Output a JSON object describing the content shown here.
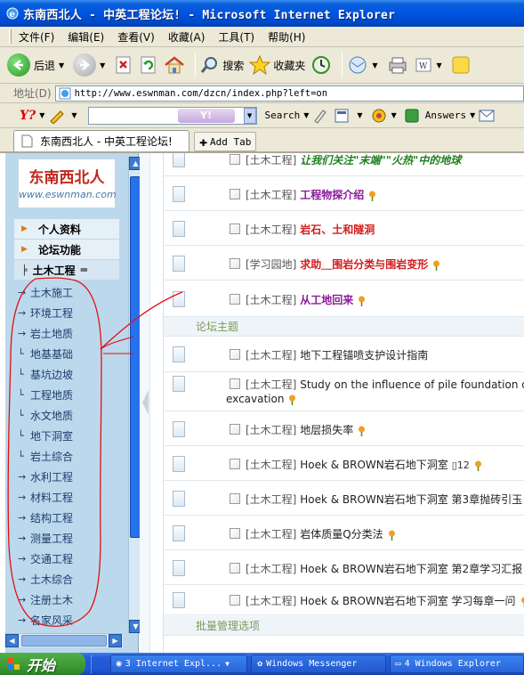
{
  "window": {
    "title": "东南西北人 - 中英工程论坛! - Microsoft Internet Explorer"
  },
  "menubar": {
    "items": [
      "文件(F)",
      "编辑(E)",
      "查看(V)",
      "收藏(A)",
      "工具(T)",
      "帮助(H)"
    ]
  },
  "toolbar": {
    "back_label": "后退",
    "search_label": "搜索",
    "favorites_label": "收藏夹"
  },
  "address": {
    "label": "地址(D)",
    "url": "http://www.eswnman.com/dzcn/index.php?left=on"
  },
  "yahoo_toolbar": {
    "logo": "Y?",
    "watermark": "Y!",
    "search_label": "Search",
    "answers_label": "Answers"
  },
  "tabs": {
    "active_tab": "东南西北人 - 中英工程论坛!",
    "add_tab_label": "Add Tab"
  },
  "left_frame": {
    "logo_cn": "东南西北人",
    "logo_en": "www.eswnman.com",
    "menu": [
      "个人资料",
      "论坛功能"
    ],
    "current_section": "土木工程",
    "categories": [
      {
        "prefix": "→",
        "label": "土木施工"
      },
      {
        "prefix": "→",
        "label": "环境工程"
      },
      {
        "prefix": "→",
        "label": "岩土地质"
      },
      {
        "prefix": "└",
        "label": "地基基础"
      },
      {
        "prefix": "└",
        "label": "基坑边坡"
      },
      {
        "prefix": "└",
        "label": "工程地质"
      },
      {
        "prefix": "└",
        "label": "水文地质"
      },
      {
        "prefix": "└",
        "label": "地下洞室"
      },
      {
        "prefix": "└",
        "label": "岩土综合"
      },
      {
        "prefix": "→",
        "label": "水利工程"
      },
      {
        "prefix": "→",
        "label": "材料工程"
      },
      {
        "prefix": "→",
        "label": "结构工程"
      },
      {
        "prefix": "→",
        "label": "测量工程"
      },
      {
        "prefix": "→",
        "label": "交通工程"
      },
      {
        "prefix": "→",
        "label": "土木综合"
      },
      {
        "prefix": "→",
        "label": "注册土木"
      },
      {
        "prefix": "→",
        "label": "名家风采"
      }
    ]
  },
  "threads_top": [
    {
      "tag": "[土木工程]",
      "title": "让我们关注\"末端\"\"火热\"中的地球",
      "style": "green",
      "pin": false
    },
    {
      "tag": "[土木工程]",
      "title": "工程物探介绍",
      "style": "purple",
      "pin": true
    },
    {
      "tag": "[土木工程]",
      "title": "岩石、土和隧洞",
      "style": "red",
      "pin": false
    },
    {
      "tag": "[学习园地]",
      "title": "求助＿围岩分类与围岩变形",
      "style": "red",
      "pin": true
    },
    {
      "tag": "[土木工程]",
      "title": "从工地回来",
      "style": "purple",
      "pin": true
    }
  ],
  "section_label": "论坛主题",
  "threads_main": [
    {
      "tag": "[土木工程]",
      "title": "地下工程锚喷支护设计指南",
      "pin": false
    },
    {
      "tag": "[土木工程]",
      "title": "Study on the influence of pile foundation due",
      "title2": "excavation",
      "pin": true
    },
    {
      "tag": "[土木工程]",
      "title": "地层损失率",
      "pin": true
    },
    {
      "tag": "[土木工程]",
      "title": "Hoek & BROWN岩石地下洞室",
      "pages": "12",
      "pin": true
    },
    {
      "tag": "[土木工程]",
      "title": "Hoek & BROWN岩石地下洞室 第3章抛砖引玉",
      "pin": false
    },
    {
      "tag": "[土木工程]",
      "title": "岩体质量Q分类法",
      "pin": true
    },
    {
      "tag": "[土木工程]",
      "title": "Hoek & BROWN岩石地下洞室 第2章学习汇报",
      "pin": false
    },
    {
      "tag": "[土木工程]",
      "title": "Hoek & BROWN岩石地下洞室 学习每章一问",
      "pin": true
    }
  ],
  "batch_label": "批量管理选项",
  "taskbar": {
    "start_label": "开始",
    "tasks": [
      "3 Internet Expl...",
      "Windows Messenger",
      "4 Windows Explorer"
    ]
  },
  "colors": {
    "title_bar": "#0054e3",
    "left_frame_bg": "#bcd8ec",
    "annotation": "#e01010",
    "thread_red": "#d21e1e",
    "thread_purple": "#8c1a9a"
  }
}
